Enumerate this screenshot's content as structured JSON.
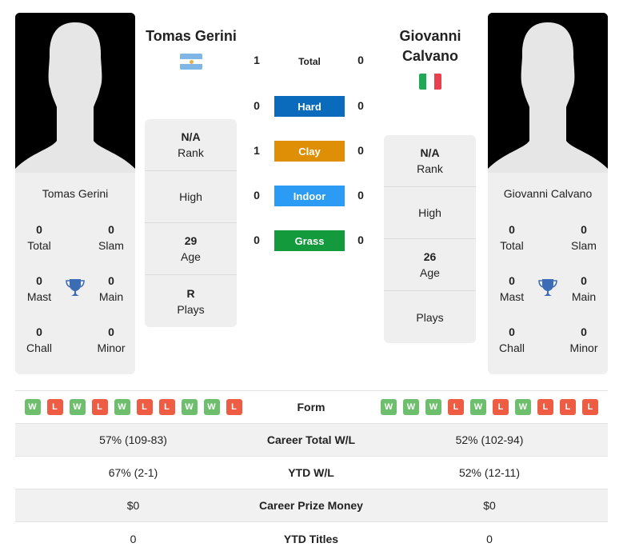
{
  "players": {
    "left": {
      "name": "Tomas Gerini",
      "title_lines": [
        "Tomas Gerini"
      ],
      "flag": "argentina-flag",
      "titles": {
        "total": "0",
        "slam": "0",
        "mast": "0",
        "main": "0",
        "chall": "0",
        "minor": "0"
      },
      "rank": "N/A",
      "high": "",
      "age": "29",
      "plays": "R"
    },
    "right": {
      "name": "Giovanni Calvano",
      "title_lines": [
        "Giovanni",
        "Calvano"
      ],
      "flag": "italy-flag",
      "titles": {
        "total": "0",
        "slam": "0",
        "mast": "0",
        "main": "0",
        "chall": "0",
        "minor": "0"
      },
      "rank": "N/A",
      "high": "",
      "age": "26",
      "plays": ""
    }
  },
  "labels": {
    "total": "Total",
    "slam": "Slam",
    "mast": "Mast",
    "main": "Main",
    "chall": "Chall",
    "minor": "Minor",
    "rank": "Rank",
    "high": "High",
    "age": "Age",
    "plays": "Plays"
  },
  "h2h": [
    {
      "label": "Total",
      "left": "1",
      "right": "0",
      "color": ""
    },
    {
      "label": "Hard",
      "left": "0",
      "right": "0",
      "color": "#0a6bbd"
    },
    {
      "label": "Clay",
      "left": "1",
      "right": "0",
      "color": "#de8f06"
    },
    {
      "label": "Indoor",
      "left": "0",
      "right": "0",
      "color": "#2b9bf4"
    },
    {
      "label": "Grass",
      "left": "0",
      "right": "0",
      "color": "#129a3d"
    }
  ],
  "comparison": {
    "form_label": "Form",
    "left_form": [
      "W",
      "L",
      "W",
      "L",
      "W",
      "L",
      "L",
      "W",
      "W",
      "L"
    ],
    "right_form": [
      "W",
      "W",
      "W",
      "L",
      "W",
      "L",
      "W",
      "L",
      "L",
      "L"
    ],
    "rows": [
      {
        "label": "Career Total W/L",
        "left": "57% (109-83)",
        "right": "52% (102-94)"
      },
      {
        "label": "YTD W/L",
        "left": "67% (2-1)",
        "right": "52% (12-11)"
      },
      {
        "label": "Career Prize Money",
        "left": "$0",
        "right": "$0"
      },
      {
        "label": "YTD Titles",
        "left": "0",
        "right": "0"
      }
    ]
  },
  "colors": {
    "win": "#6dbf6d",
    "loss": "#ee5c43",
    "trophy": "#3b6cb5"
  }
}
